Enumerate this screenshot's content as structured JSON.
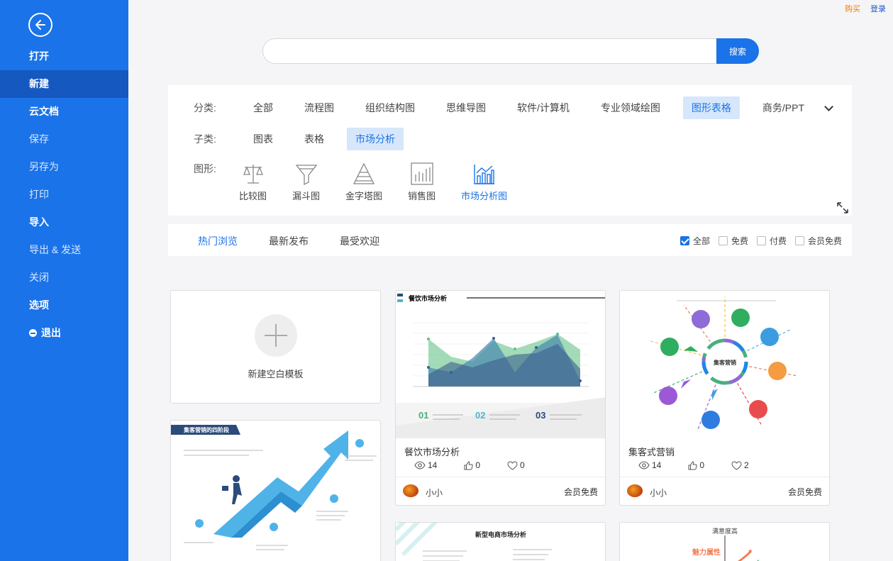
{
  "top_links": {
    "buy": "购买",
    "login": "登录"
  },
  "sidebar": {
    "items": [
      {
        "label": "打开",
        "bold": true
      },
      {
        "label": "新建",
        "bold": true,
        "active": true
      },
      {
        "label": "云文档",
        "bold": true
      },
      {
        "label": "保存"
      },
      {
        "label": "另存为"
      },
      {
        "label": "打印"
      },
      {
        "label": "导入",
        "bold": true
      },
      {
        "label": "导出 & 发送"
      },
      {
        "label": "关闭"
      },
      {
        "label": "选项",
        "bold": true
      },
      {
        "label": "退出",
        "bold": true
      }
    ]
  },
  "search": {
    "value": "",
    "placeholder": "",
    "button": "搜索"
  },
  "filters": {
    "category_label": "分类:",
    "categories": [
      "全部",
      "流程图",
      "组织结构图",
      "思维导图",
      "软件/计算机",
      "专业领域绘图",
      "图形表格",
      "商务/PPT"
    ],
    "category_active": "图形表格",
    "sub_label": "子类:",
    "subcategories": [
      "图表",
      "表格",
      "市场分析"
    ],
    "sub_active": "市场分析",
    "shape_label": "图形:",
    "shapes": [
      "比较图",
      "漏斗图",
      "金字塔图",
      "销售图",
      "市场分析图"
    ],
    "shape_active": "市场分析图"
  },
  "sort": {
    "tabs": [
      "热门浏览",
      "最新发布",
      "最受欢迎"
    ],
    "active": "热门浏览",
    "checks": [
      {
        "label": "全部",
        "checked": true
      },
      {
        "label": "免费",
        "checked": false
      },
      {
        "label": "付费",
        "checked": false
      },
      {
        "label": "会员免费",
        "checked": false
      }
    ]
  },
  "blank_template": {
    "label": "新建空白模板"
  },
  "cards": [
    {
      "title": "餐饮市场分析",
      "thumb_title": "餐饮市场分析",
      "views": "14",
      "likes": "0",
      "favorites": "0",
      "author": "小小",
      "price": "会员免费",
      "nums": [
        "01",
        "02",
        "03"
      ]
    },
    {
      "title": "集客式营销",
      "thumb_center": "集客营销",
      "views": "14",
      "likes": "0",
      "favorites": "2",
      "author": "小小",
      "price": "会员免费"
    },
    {
      "thumb_title": "集客营销的四阶段"
    },
    {
      "thumb_title": "新型电商市场分析"
    },
    {
      "thumb_title": "满意度高",
      "thumb_sub": "魅力属性"
    }
  ],
  "colors": {
    "accent": "#1a73e8",
    "sidebar": "#1a73e8",
    "sidebar_active": "#1558c0"
  }
}
